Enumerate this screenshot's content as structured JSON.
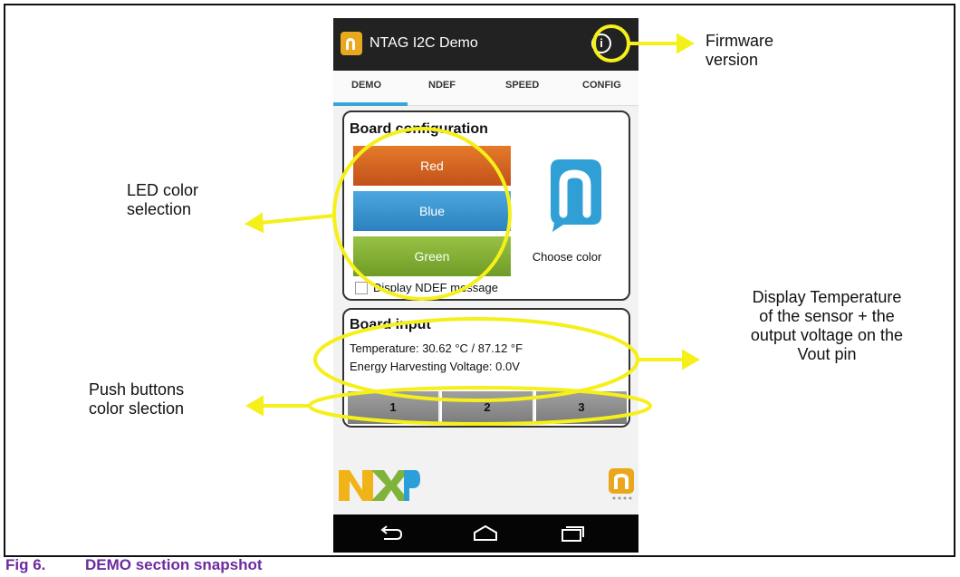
{
  "app": {
    "title": "NTAG I2C Demo"
  },
  "tabs": [
    "DEMO",
    "NDEF",
    "SPEED",
    "CONFIG"
  ],
  "board_config": {
    "title": "Board configuration",
    "led_buttons": [
      "Red",
      "Blue",
      "Green"
    ],
    "choose_color_label": "Choose color",
    "ndef_checkbox_label": "Display NDEF message"
  },
  "board_input": {
    "title": "Board input",
    "temperature": "Temperature: 30.62 °C / 87.12 °F",
    "energy": "Energy Harvesting Voltage: 0.0V",
    "push_buttons": [
      "1",
      "2",
      "3"
    ]
  },
  "annotations": {
    "firmware_l1": "Firmware",
    "firmware_l2": "version",
    "led_l1": "LED color",
    "led_l2": "selection",
    "temp_l1": "Display Temperature",
    "temp_l2": "of the sensor + the",
    "temp_l3": "output voltage on the",
    "temp_l4": "Vout pin",
    "push_l1": "Push buttons",
    "push_l2": "color slection"
  },
  "caption": {
    "number": "Fig 6.",
    "text": "DEMO section snapshot"
  },
  "colors": {
    "annotation": "#f5ef1a",
    "caption": "#6d2aa0",
    "tab_indicator": "#37a5db"
  }
}
